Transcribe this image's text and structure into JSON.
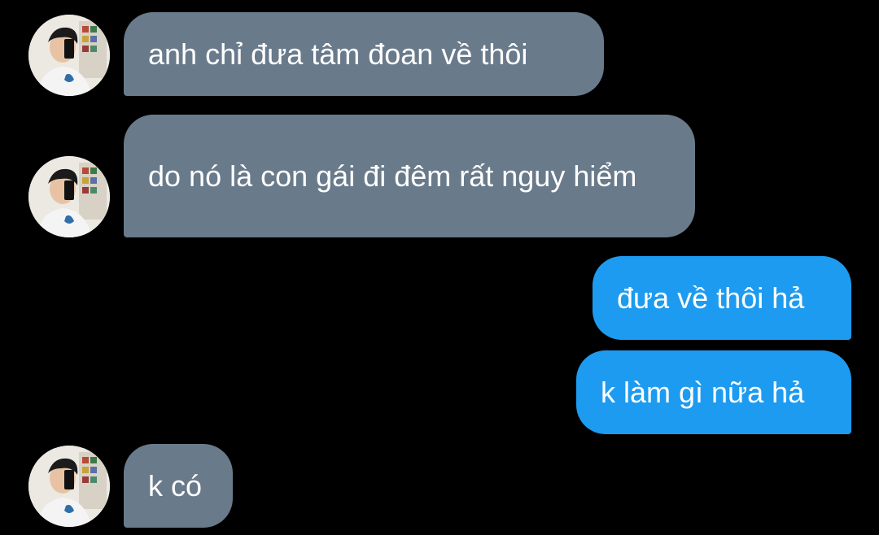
{
  "messages": [
    {
      "side": "incoming",
      "text": "anh chỉ đưa tâm đoan về thôi"
    },
    {
      "side": "incoming",
      "text": "do nó là con gái đi đêm rất nguy hiểm"
    },
    {
      "side": "outgoing",
      "text": "đưa về thôi hả"
    },
    {
      "side": "outgoing",
      "text": "k làm gì nữa hả"
    },
    {
      "side": "incoming",
      "text": "k có"
    }
  ],
  "colors": {
    "background": "#000000",
    "incoming_bubble": "#697a8b",
    "outgoing_bubble": "#1d9bf0",
    "text": "#ffffff"
  },
  "icons": {
    "avatar": "contact-avatar-photo"
  }
}
